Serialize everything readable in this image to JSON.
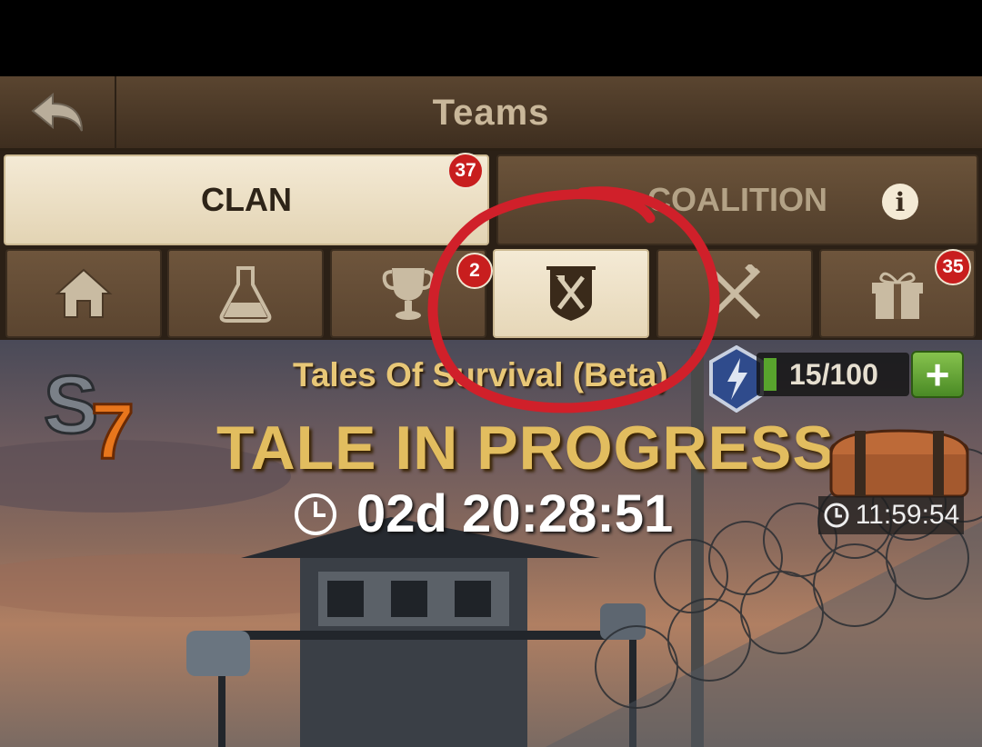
{
  "header": {
    "title": "Teams",
    "back_icon": "back-arrow-icon"
  },
  "tabs": [
    {
      "label": "CLAN",
      "badge": "37",
      "active": true
    },
    {
      "label": "COALITION",
      "info_icon": "info-icon",
      "info_glyph": "i"
    }
  ],
  "subtabs": [
    {
      "icon": "home-icon"
    },
    {
      "icon": "flask-icon"
    },
    {
      "icon": "trophy-icon",
      "badge": "2"
    },
    {
      "icon": "crossed-tools-banner-icon",
      "active": true
    },
    {
      "icon": "crossed-weapons-icon"
    },
    {
      "icon": "gift-icon",
      "badge": "35"
    }
  ],
  "event": {
    "season_logo": "S7",
    "title": "Tales Of Survival (Beta)",
    "energy": "15/100",
    "energy_fraction": 0.15,
    "plus_label": "+",
    "status": "TALE IN PROGRESS",
    "countdown": "02d 20:28:51",
    "chest_timer": "11:59:54"
  },
  "colors": {
    "accent_gold": "#e2bd5f",
    "annotation_red": "#d0202a",
    "active_tab": "#f4ead5"
  }
}
